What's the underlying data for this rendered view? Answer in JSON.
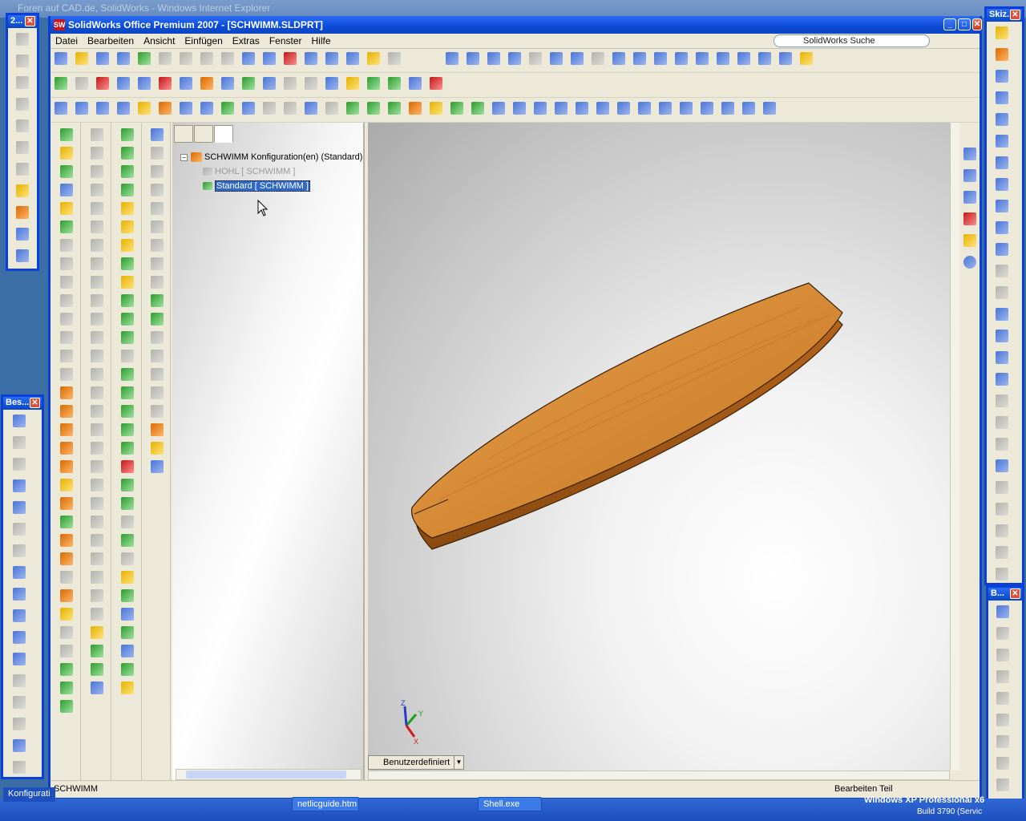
{
  "background_window": {
    "title": "Foren auf CAD.de, SolidWorks - Windows Internet Explorer"
  },
  "left_toolbar_top": {
    "title": "2..."
  },
  "left_toolbar_bottom": {
    "title": "Bes..."
  },
  "right_toolbar_top": {
    "title": "Skiz..."
  },
  "right_toolbar_bottom": {
    "title": "B..."
  },
  "app": {
    "title": "SolidWorks Office Premium 2007 - [SCHWIMM.SLDPRT]",
    "logo_text": "SW",
    "search_placeholder": "SolidWorks Suche"
  },
  "menu": [
    "Datei",
    "Bearbeiten",
    "Ansicht",
    "Einfügen",
    "Extras",
    "Fenster",
    "Hilfe"
  ],
  "tree": {
    "root": "SCHWIMM Konfiguration(en)  (Standard)",
    "item1": "HOHL [ SCHWIMM ]",
    "item2": "Standard [ SCHWIMM ]"
  },
  "viewport": {
    "view_combo": "Benutzerdefiniert",
    "triad": {
      "x": "X",
      "y": "Y",
      "z": "Z"
    },
    "model_color": "#d68a35"
  },
  "status": {
    "left": "SCHWIMM",
    "right": "Bearbeiten Teil"
  },
  "taskbar": {
    "item_konfig": "Konfigurati",
    "item_netlic": "netlicguide.htm",
    "item_shell": "Shell.exe",
    "os_label": "Windows XP Professional x6",
    "build": "Build 3790 (Servic"
  }
}
